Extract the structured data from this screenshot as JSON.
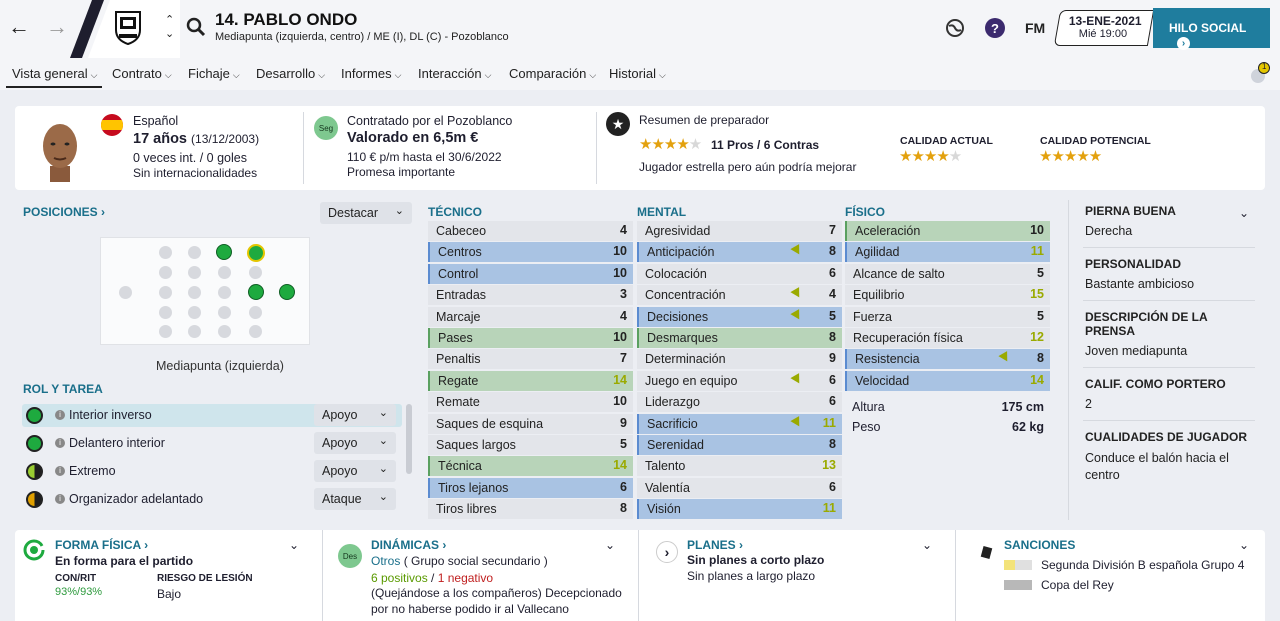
{
  "header": {
    "player_title": "14. PABLO ONDO",
    "player_subtitle": "Mediapunta (izquierda, centro) / ME (I), DL (C) - Pozoblanco",
    "date": "13-ENE-2021",
    "time": "Mié 19:00",
    "fm_label": "FM",
    "social_button": "HILO SOCIAL",
    "notif_count": "1"
  },
  "tabs": [
    "Vista general",
    "Contrato",
    "Fichaje",
    "Desarrollo",
    "Informes",
    "Interacción",
    "Comparación",
    "Historial"
  ],
  "summary": {
    "nationality": "Español",
    "age": "17 años",
    "birth": "(13/12/2003)",
    "caps": "0 veces int. / 0 goles",
    "intl": "Sin internacionalidades",
    "contract_badge": "Seg",
    "contract_title": "Contratado por el Pozoblanco",
    "value": "Valorado en 6,5m €",
    "wage": "110 € p/m hasta el 30/6/2022",
    "promise": "Promesa importante",
    "coach_title": "Resumen de preparador",
    "coach_rating": 4.5,
    "pros_cons": "11 Pros / 6 Contras",
    "coach_note": "Jugador estrella pero aún podría mejorar",
    "current_label": "CALIDAD ACTUAL",
    "current_stars": 4.5,
    "potential_label": "CALIDAD POTENCIAL",
    "potential_stars": 5
  },
  "positions": {
    "title": "POSICIONES",
    "highlight": "Destacar",
    "position_label": "Mediapunta (izquierda)"
  },
  "roles": {
    "title": "ROL Y TAREA",
    "items": [
      {
        "name": "Interior inverso",
        "duty": "Apoyo"
      },
      {
        "name": "Delantero interior",
        "duty": "Apoyo"
      },
      {
        "name": "Extremo",
        "duty": "Apoyo"
      },
      {
        "name": "Organizador adelantado",
        "duty": "Ataque"
      }
    ]
  },
  "tecnico": {
    "title": "TÉCNICO",
    "attrs": [
      {
        "n": "Cabeceo",
        "v": "4"
      },
      {
        "n": "Centros",
        "v": "10"
      },
      {
        "n": "Control",
        "v": "10"
      },
      {
        "n": "Entradas",
        "v": "3"
      },
      {
        "n": "Marcaje",
        "v": "4"
      },
      {
        "n": "Pases",
        "v": "10"
      },
      {
        "n": "Penaltis",
        "v": "7"
      },
      {
        "n": "Regate",
        "v": "14"
      },
      {
        "n": "Remate",
        "v": "10"
      },
      {
        "n": "Saques de esquina",
        "v": "9"
      },
      {
        "n": "Saques largos",
        "v": "5"
      },
      {
        "n": "Técnica",
        "v": "14"
      },
      {
        "n": "Tiros lejanos",
        "v": "6"
      },
      {
        "n": "Tiros libres",
        "v": "8"
      }
    ]
  },
  "mental": {
    "title": "MENTAL",
    "attrs": [
      {
        "n": "Agresividad",
        "v": "7"
      },
      {
        "n": "Anticipación",
        "v": "8"
      },
      {
        "n": "Colocación",
        "v": "6"
      },
      {
        "n": "Concentración",
        "v": "4"
      },
      {
        "n": "Decisiones",
        "v": "5"
      },
      {
        "n": "Desmarques",
        "v": "8"
      },
      {
        "n": "Determinación",
        "v": "9"
      },
      {
        "n": "Juego en equipo",
        "v": "6"
      },
      {
        "n": "Liderazgo",
        "v": "6"
      },
      {
        "n": "Sacrificio",
        "v": "11"
      },
      {
        "n": "Serenidad",
        "v": "8"
      },
      {
        "n": "Talento",
        "v": "13"
      },
      {
        "n": "Valentía",
        "v": "6"
      },
      {
        "n": "Visión",
        "v": "11"
      }
    ]
  },
  "fisico": {
    "title": "FÍSICO",
    "attrs": [
      {
        "n": "Aceleración",
        "v": "10"
      },
      {
        "n": "Agilidad",
        "v": "11"
      },
      {
        "n": "Alcance de salto",
        "v": "5"
      },
      {
        "n": "Equilibrio",
        "v": "15"
      },
      {
        "n": "Fuerza",
        "v": "5"
      },
      {
        "n": "Recuperación física",
        "v": "12"
      },
      {
        "n": "Resistencia",
        "v": "8"
      },
      {
        "n": "Velocidad",
        "v": "14"
      }
    ],
    "height_label": "Altura",
    "height": "175 cm",
    "weight_label": "Peso",
    "weight": "62 kg"
  },
  "side": {
    "foot_t": "PIERNA BUENA",
    "foot_v": "Derecha",
    "pers_t": "PERSONALIDAD",
    "pers_v": "Bastante ambicioso",
    "press_t": "DESCRIPCIÓN DE LA PRENSA",
    "press_v": "Joven mediapunta",
    "gk_t": "CALIF. COMO PORTERO",
    "gk_v": "2",
    "qual_t": "CUALIDADES DE JUGADOR",
    "qual_v": "Conduce el balón hacia el centro"
  },
  "footer": {
    "forma_t": "FORMA FÍSICA",
    "forma_v": "En forma para el partido",
    "conrit_t": "CON/RIT",
    "conrit_v": "93%/93%",
    "riesgo_t": "RIESGO DE LESIÓN",
    "riesgo_v": "Bajo",
    "din_t": "DINÁMICAS",
    "din_badge": "Des",
    "din_group": "Otros",
    "din_group2": "( Grupo social secundario )",
    "din_pos": "6 positivos",
    "din_neg": "1 negativo",
    "din_note": "(Quejándose a los compañeros) Decepcionado por no haberse podido ir al Vallecano",
    "planes_t": "PLANES",
    "planes_v1": "Sin planes a corto plazo",
    "planes_v2": "Sin planes a largo plazo",
    "sanc_t": "SANCIONES",
    "sanc_1": "Segunda División B española Grupo 4",
    "sanc_2": "Copa del Rey"
  },
  "colors": {
    "accent": "#1a6f8a",
    "good": "#9aaa00",
    "highlight_blue": "#a9c3e3",
    "highlight_green": "#b8d4b9"
  }
}
